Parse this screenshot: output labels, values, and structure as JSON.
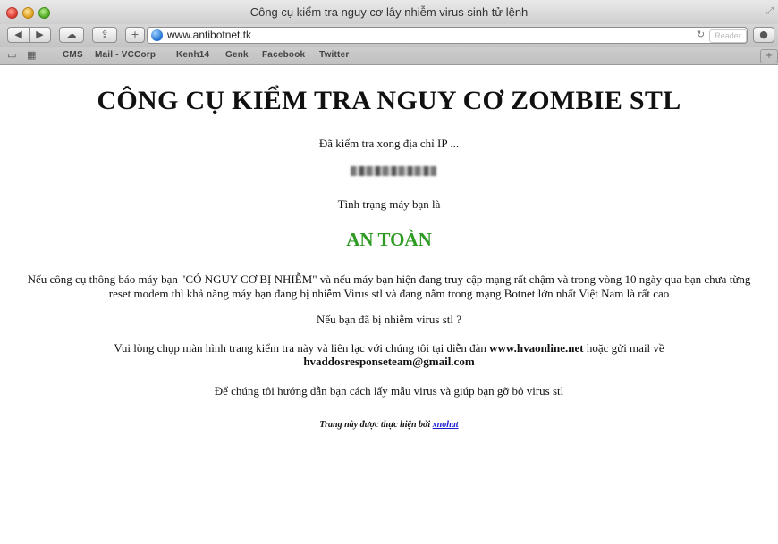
{
  "window": {
    "title": "Công cụ kiểm tra nguy cơ lây nhiễm virus sinh tử lệnh",
    "url": "www.antibotnet.tk",
    "reader_label": "Reader"
  },
  "bookmarks": [
    "CMS",
    "Mail - VCCorp",
    "Kenh14",
    "Genk",
    "Facebook",
    "Twitter"
  ],
  "icons": {
    "back": "back-arrow-icon",
    "forward": "forward-arrow-icon",
    "icloud": "cloud-icon",
    "share": "share-icon",
    "add": "plus-icon",
    "site": "globe-icon",
    "reload": "reload-icon"
  },
  "colors": {
    "status_safe": "#2f9a24",
    "link": "#1a1ad0"
  },
  "page": {
    "heading": "CÔNG CỤ KIỂM TRA NGUY CƠ ZOMBIE STL",
    "checked_ip_text": "Đã kiểm tra xong địa chỉ IP ...",
    "machine_status_label": "Tình trạng máy bạn là",
    "status": "AN TOÀN",
    "warning": "Nếu công cụ thông báo máy bạn \"CÓ NGUY CƠ BỊ NHIỄM\" và nếu máy bạn hiện đang truy cập mạng rất chậm và trong vòng 10 ngày qua bạn chưa từng reset modem thì khả năng máy bạn đang bị nhiễm Virus stl và đang nằm trong mạng Botnet lớn nhất Việt Nam là rất cao",
    "question": "Nếu bạn đã bị nhiễm virus stl ?",
    "forum_prefix": "Vui lòng chụp màn hình trang kiểm tra này và liên lạc với chúng tôi tại diễn đàn",
    "forum_site": "www.hvaonline.net",
    "forum_middle": "hoặc gửi mail về",
    "email": "hvaddosresponseteam@gmail.com",
    "guide": "Để chúng tôi hướng dẫn bạn cách lấy mẫu virus và giúp bạn gỡ bỏ virus stl",
    "credit_text": "Trang này được thực hiện bởi",
    "credit_link": "xnohat"
  }
}
